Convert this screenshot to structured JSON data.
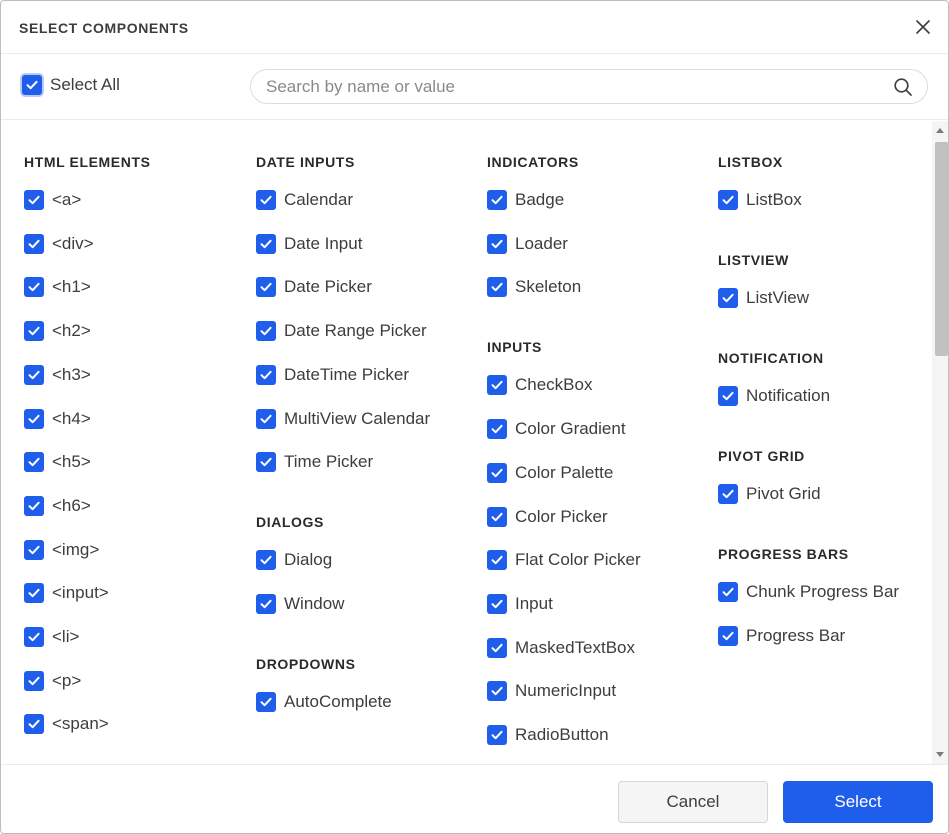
{
  "dialog": {
    "title": "SELECT COMPONENTS"
  },
  "toolbar": {
    "select_all_label": "Select All",
    "select_all_checked": true,
    "search_placeholder": "Search by name or value",
    "search_value": ""
  },
  "columns": [
    {
      "sections": [
        {
          "title": "HTML ELEMENTS",
          "items": [
            "<a>",
            "<div>",
            "<h1>",
            "<h2>",
            "<h3>",
            "<h4>",
            "<h5>",
            "<h6>",
            "<img>",
            "<input>",
            "<li>",
            "<p>",
            "<span>"
          ]
        }
      ]
    },
    {
      "sections": [
        {
          "title": "DATE INPUTS",
          "items": [
            "Calendar",
            "Date Input",
            "Date Picker",
            "Date Range Picker",
            "DateTime Picker",
            "MultiView Calendar",
            "Time Picker"
          ]
        },
        {
          "title": "DIALOGS",
          "items": [
            "Dialog",
            "Window"
          ]
        },
        {
          "title": "DROPDOWNS",
          "items": [
            "AutoComplete"
          ]
        }
      ]
    },
    {
      "sections": [
        {
          "title": "INDICATORS",
          "items": [
            "Badge",
            "Loader",
            "Skeleton"
          ]
        },
        {
          "title": "INPUTS",
          "items": [
            "CheckBox",
            "Color Gradient",
            "Color Palette",
            "Color Picker",
            "Flat Color Picker",
            "Input",
            "MaskedTextBox",
            "NumericInput",
            "RadioButton"
          ]
        }
      ]
    },
    {
      "sections": [
        {
          "title": "LISTBOX",
          "items": [
            "ListBox"
          ]
        },
        {
          "title": "LISTVIEW",
          "items": [
            "ListView"
          ]
        },
        {
          "title": "NOTIFICATION",
          "items": [
            "Notification"
          ]
        },
        {
          "title": "PIVOT GRID",
          "items": [
            "Pivot Grid"
          ]
        },
        {
          "title": "PROGRESS BARS",
          "items": [
            "Chunk Progress Bar",
            "Progress Bar"
          ]
        }
      ]
    }
  ],
  "footer": {
    "cancel_label": "Cancel",
    "select_label": "Select"
  },
  "colors": {
    "accent": "#1f5eeb",
    "checkbox_fill": "#1f5eeb",
    "text": "#3d3d3d"
  },
  "icons": {
    "close": "close-icon",
    "search": "search-icon",
    "checkbox": "checkmark-icon"
  }
}
